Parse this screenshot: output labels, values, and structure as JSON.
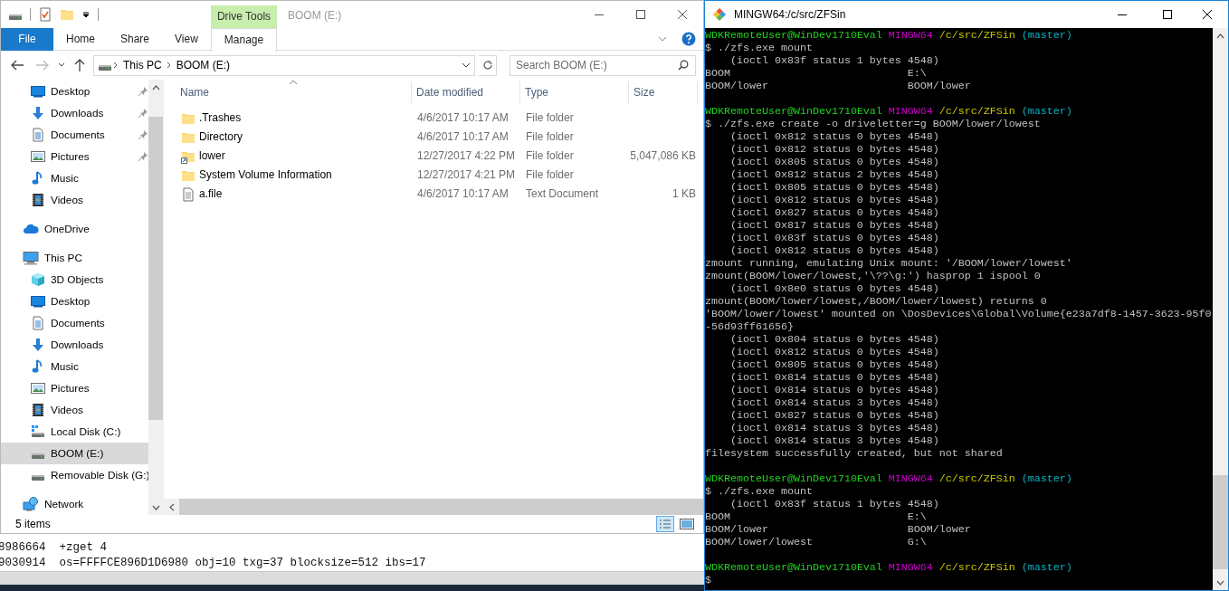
{
  "explorer": {
    "title": "BOOM (E:)",
    "contextual_tab_group": "Drive Tools",
    "ribbon_tabs": [
      {
        "label": "File",
        "kind": "file",
        "selected": false
      },
      {
        "label": "Home",
        "kind": "tab",
        "selected": false
      },
      {
        "label": "Share",
        "kind": "tab",
        "selected": false
      },
      {
        "label": "View",
        "kind": "tab",
        "selected": false
      },
      {
        "label": "Manage",
        "kind": "tab",
        "selected": true
      }
    ],
    "address": {
      "crumbs": [
        "This PC",
        "BOOM (E:)"
      ]
    },
    "search": {
      "placeholder": "Search BOOM (E:)"
    },
    "nav_pane": {
      "quick_access": [
        {
          "label": "Desktop",
          "kind": "desktop",
          "pinned": true,
          "selected": false
        },
        {
          "label": "Downloads",
          "kind": "downloads",
          "pinned": true,
          "selected": false
        },
        {
          "label": "Documents",
          "kind": "documents",
          "pinned": true,
          "selected": false
        },
        {
          "label": "Pictures",
          "kind": "pictures",
          "pinned": true,
          "selected": false
        },
        {
          "label": "Music",
          "kind": "music",
          "pinned": false,
          "selected": false
        },
        {
          "label": "Videos",
          "kind": "videos",
          "pinned": false,
          "selected": false
        }
      ],
      "locations": [
        {
          "label": "OneDrive",
          "kind": "onedrive",
          "selected": false
        },
        {
          "label": "This PC",
          "kind": "pc",
          "selected": false,
          "children": [
            {
              "label": "3D Objects",
              "kind": "objects3d",
              "selected": false
            },
            {
              "label": "Desktop",
              "kind": "desktop",
              "selected": false
            },
            {
              "label": "Documents",
              "kind": "documents",
              "selected": false
            },
            {
              "label": "Downloads",
              "kind": "downloads",
              "selected": false
            },
            {
              "label": "Music",
              "kind": "music",
              "selected": false
            },
            {
              "label": "Pictures",
              "kind": "pictures",
              "selected": false
            },
            {
              "label": "Videos",
              "kind": "videos",
              "selected": false
            },
            {
              "label": "Local Disk (C:)",
              "kind": "local_disk",
              "selected": false
            },
            {
              "label": "BOOM (E:)",
              "kind": "drive",
              "selected": true
            },
            {
              "label": "Removable Disk (G:)",
              "kind": "drive",
              "selected": false
            }
          ]
        },
        {
          "label": "Network",
          "kind": "network",
          "selected": false
        }
      ]
    },
    "columns": [
      "Name",
      "Date modified",
      "Type",
      "Size"
    ],
    "rows": [
      {
        "name": ".Trashes",
        "kind": "folder",
        "date": "4/6/2017 10:17 AM",
        "type": "File folder",
        "selected": false
      },
      {
        "name": "Directory",
        "kind": "folder",
        "date": "4/6/2017 10:17 AM",
        "type": "File folder",
        "selected": false
      },
      {
        "name": "lower",
        "kind": "folder_link",
        "date": "12/27/2017 4:22 PM",
        "type": "File folder",
        "size": "5,047,086 KB",
        "selected": false
      },
      {
        "name": "System Volume Information",
        "kind": "folder",
        "date": "12/27/2017 4:21 PM",
        "type": "File folder",
        "selected": false
      },
      {
        "name": "a.file",
        "kind": "text_file",
        "date": "4/6/2017 10:17 AM",
        "type": "Text Document",
        "size": "1 KB",
        "selected": false
      }
    ],
    "status_bar": "5 items"
  },
  "background_console": {
    "lines": [
      "8986664  +zget 4",
      "9030914  os=FFFFCE896D1D6980 obj=10 txg=37 blocksize=512 ibs=17"
    ]
  },
  "terminal": {
    "title": "MINGW64:/c/src/ZFSin",
    "lines": [
      {
        "kind": "prompt",
        "user_host": "WDKRemoteUser@WinDev1710Eval",
        "shell": "MINGW64",
        "path": "/c/src/ZFSin",
        "branch": "(master)"
      },
      {
        "kind": "command",
        "text": "$ ./zfs.exe mount"
      },
      {
        "kind": "indented",
        "text": "(ioctl 0x83f status 1 bytes 4548)"
      },
      {
        "kind": "mount",
        "dataset": "BOOM",
        "mountpoint": "E:\\"
      },
      {
        "kind": "mount",
        "dataset": "BOOM/lower",
        "mountpoint": "BOOM/lower"
      },
      {
        "kind": "blank"
      },
      {
        "kind": "prompt",
        "user_host": "WDKRemoteUser@WinDev1710Eval",
        "shell": "MINGW64",
        "path": "/c/src/ZFSin",
        "branch": "(master)"
      },
      {
        "kind": "command",
        "text": "$ ./zfs.exe create -o driveletter=g BOOM/lower/lowest"
      },
      {
        "kind": "indented",
        "text": "(ioctl 0x812 status 0 bytes 4548)"
      },
      {
        "kind": "indented",
        "text": "(ioctl 0x812 status 0 bytes 4548)"
      },
      {
        "kind": "indented",
        "text": "(ioctl 0x805 status 0 bytes 4548)"
      },
      {
        "kind": "indented",
        "text": "(ioctl 0x812 status 2 bytes 4548)"
      },
      {
        "kind": "indented",
        "text": "(ioctl 0x805 status 0 bytes 4548)"
      },
      {
        "kind": "indented",
        "text": "(ioctl 0x812 status 0 bytes 4548)"
      },
      {
        "kind": "indented",
        "text": "(ioctl 0x827 status 0 bytes 4548)"
      },
      {
        "kind": "indented",
        "text": "(ioctl 0x817 status 0 bytes 4548)"
      },
      {
        "kind": "indented",
        "text": "(ioctl 0x83f status 0 bytes 4548)"
      },
      {
        "kind": "indented",
        "text": "(ioctl 0x812 status 0 bytes 4548)"
      },
      {
        "kind": "output",
        "text": "zmount running, emulating Unix mount: '/BOOM/lower/lowest'"
      },
      {
        "kind": "output",
        "text": "zmount(BOOM/lower/lowest,'\\??\\g:') hasprop 1 ispool 0"
      },
      {
        "kind": "indented",
        "text": "(ioctl 0x8e0 status 0 bytes 4548)"
      },
      {
        "kind": "output",
        "text": "zmount(BOOM/lower/lowest,/BOOM/lower/lowest) returns 0"
      },
      {
        "kind": "output",
        "text": "'BOOM/lower/lowest' mounted on \\DosDevices\\Global\\Volume{e23a7df8-1457-3623-95f0-56d93ff61656}"
      },
      {
        "kind": "indented",
        "text": "(ioctl 0x804 status 0 bytes 4548)"
      },
      {
        "kind": "indented",
        "text": "(ioctl 0x812 status 0 bytes 4548)"
      },
      {
        "kind": "indented",
        "text": "(ioctl 0x805 status 0 bytes 4548)"
      },
      {
        "kind": "indented",
        "text": "(ioctl 0x814 status 0 bytes 4548)"
      },
      {
        "kind": "indented",
        "text": "(ioctl 0x814 status 0 bytes 4548)"
      },
      {
        "kind": "indented",
        "text": "(ioctl 0x814 status 3 bytes 4548)"
      },
      {
        "kind": "indented",
        "text": "(ioctl 0x827 status 0 bytes 4548)"
      },
      {
        "kind": "indented",
        "text": "(ioctl 0x814 status 3 bytes 4548)"
      },
      {
        "kind": "indented",
        "text": "(ioctl 0x814 status 3 bytes 4548)"
      },
      {
        "kind": "output",
        "text": "filesystem successfully created, but not shared"
      },
      {
        "kind": "blank"
      },
      {
        "kind": "prompt",
        "user_host": "WDKRemoteUser@WinDev1710Eval",
        "shell": "MINGW64",
        "path": "/c/src/ZFSin",
        "branch": "(master)"
      },
      {
        "kind": "command",
        "text": "$ ./zfs.exe mount"
      },
      {
        "kind": "indented",
        "text": "(ioctl 0x83f status 1 bytes 4548)"
      },
      {
        "kind": "mount",
        "dataset": "BOOM",
        "mountpoint": "E:\\"
      },
      {
        "kind": "mount",
        "dataset": "BOOM/lower",
        "mountpoint": "BOOM/lower"
      },
      {
        "kind": "mount",
        "dataset": "BOOM/lower/lowest",
        "mountpoint": "G:\\"
      },
      {
        "kind": "blank"
      },
      {
        "kind": "prompt",
        "user_host": "WDKRemoteUser@WinDev1710Eval",
        "shell": "MINGW64",
        "path": "/c/src/ZFSin",
        "branch": "(master)"
      },
      {
        "kind": "command",
        "text": "$"
      }
    ]
  }
}
